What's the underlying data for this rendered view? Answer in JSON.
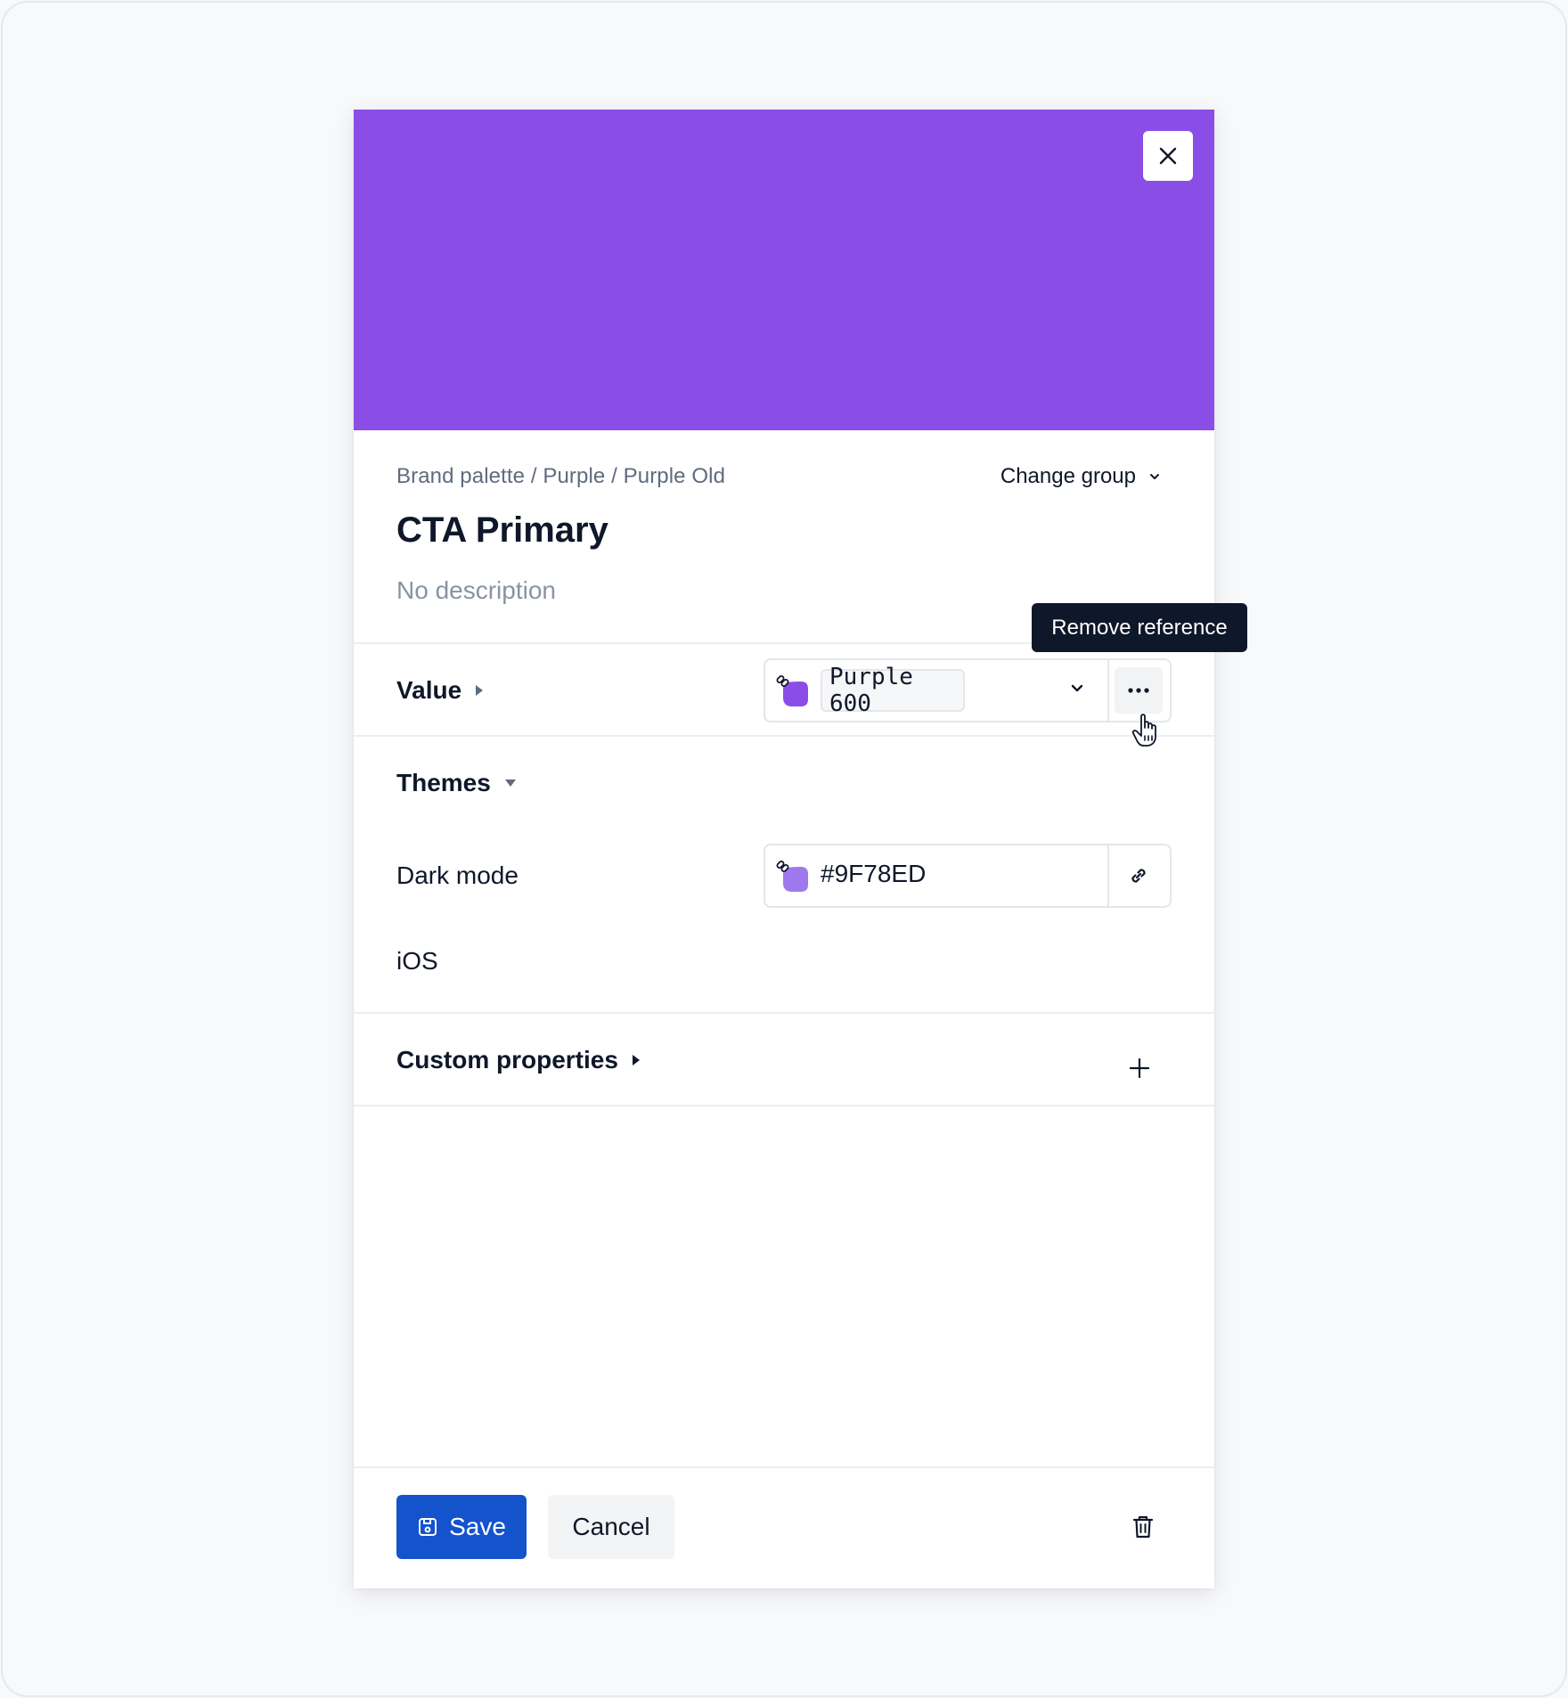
{
  "token": {
    "breadcrumb": "Brand palette / Purple / Purple Old",
    "change_group_label": "Change group",
    "title": "CTA Primary",
    "description": "No description",
    "color": "#8a4ee6"
  },
  "value": {
    "section_label": "Value",
    "reference_label": "Purple 600",
    "swatch_color": "#8a4ee6",
    "tooltip": "Remove reference"
  },
  "themes": {
    "section_label": "Themes",
    "rows": [
      {
        "label": "Dark mode",
        "value": "#9F78ED",
        "swatch_color": "#9f78ed"
      },
      {
        "label": "iOS"
      }
    ]
  },
  "custom_properties": {
    "section_label": "Custom properties"
  },
  "footer": {
    "save_label": "Save",
    "cancel_label": "Cancel",
    "save_color": "#1453cc"
  },
  "icons": [
    "close-icon",
    "chevron-down-icon",
    "caret-right-icon",
    "caret-down-icon",
    "link-icon",
    "more-horizontal-icon",
    "plus-icon",
    "save-icon",
    "trash-icon",
    "pointer-hand-icon"
  ]
}
